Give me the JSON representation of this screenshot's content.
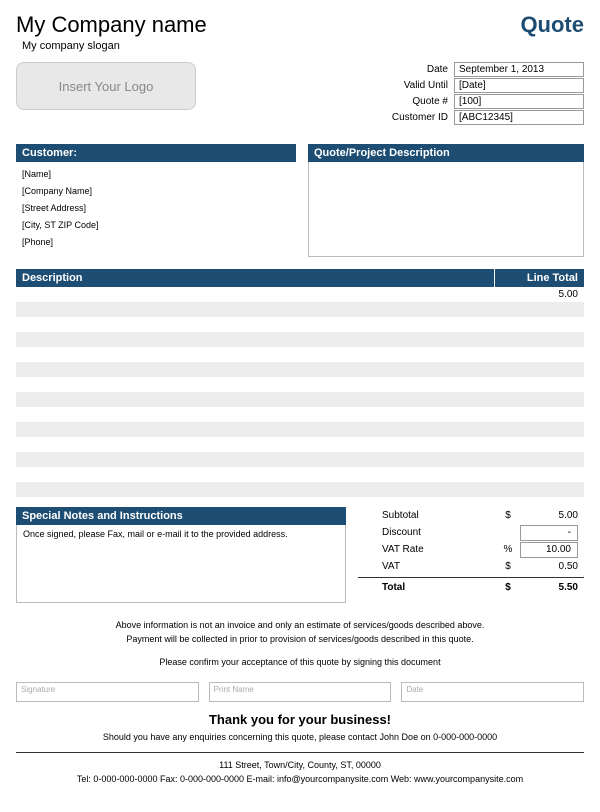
{
  "header": {
    "company_name": "My Company name",
    "slogan": "My company slogan",
    "quote_title": "Quote",
    "logo_placeholder": "Insert Your Logo"
  },
  "meta": {
    "date_label": "Date",
    "date_value": "September 1, 2013",
    "valid_label": "Valid Until",
    "valid_value": "[Date]",
    "quoteno_label": "Quote #",
    "quoteno_value": "[100]",
    "custid_label": "Customer ID",
    "custid_value": "[ABC12345]"
  },
  "customer": {
    "header": "Customer:",
    "lines": [
      "[Name]",
      "[Company Name]",
      "[Street Address]",
      "[City, ST  ZIP Code]",
      "[Phone]"
    ]
  },
  "project": {
    "header": "Quote/Project Description"
  },
  "items": {
    "desc_header": "Description",
    "total_header": "Line Total",
    "rows": [
      {
        "desc": "",
        "total": "5.00"
      },
      {
        "desc": "",
        "total": ""
      },
      {
        "desc": "",
        "total": ""
      },
      {
        "desc": "",
        "total": ""
      },
      {
        "desc": "",
        "total": ""
      },
      {
        "desc": "",
        "total": ""
      },
      {
        "desc": "",
        "total": ""
      },
      {
        "desc": "",
        "total": ""
      },
      {
        "desc": "",
        "total": ""
      },
      {
        "desc": "",
        "total": ""
      },
      {
        "desc": "",
        "total": ""
      },
      {
        "desc": "",
        "total": ""
      },
      {
        "desc": "",
        "total": ""
      },
      {
        "desc": "",
        "total": ""
      }
    ]
  },
  "notes": {
    "header": "Special Notes and Instructions",
    "body": "Once signed, please Fax, mail or e-mail it to the provided address."
  },
  "totals": {
    "subtotal_label": "Subtotal",
    "subtotal_sym": "$",
    "subtotal_val": "5.00",
    "discount_label": "Discount",
    "discount_val": "-",
    "vatrate_label": "VAT Rate",
    "vatrate_sym": "%",
    "vatrate_val": "10.00",
    "vat_label": "VAT",
    "vat_sym": "$",
    "vat_val": "0.50",
    "total_label": "Total",
    "total_sym": "$",
    "total_val": "5.50"
  },
  "fineprint": {
    "line1": "Above information is not an invoice and only an estimate of services/goods described above.",
    "line2": "Payment will be collected in prior to provision of services/goods described in this quote.",
    "line3": "Please confirm your acceptance of this quote by signing this document"
  },
  "signature": {
    "sig_label": "Signature",
    "name_label": "Print Name",
    "date_label": "Date"
  },
  "closing": {
    "thanks": "Thank you for your business!",
    "enquiry": "Should you have any enquiries concerning this quote, please contact John Doe on 0-000-000-0000",
    "address": "111 Street, Town/City, County, ST, 00000",
    "contact": "Tel: 0-000-000-0000 Fax: 0-000-000-0000 E-mail: info@yourcompanysite.com Web: www.yourcompanysite.com"
  }
}
